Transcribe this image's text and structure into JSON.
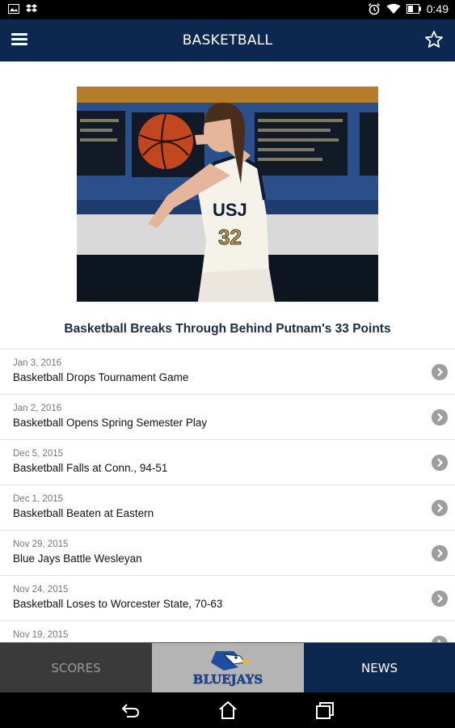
{
  "status_bar": {
    "time": "0:49",
    "left_icons": [
      "gallery-icon",
      "dropbox-icon"
    ],
    "right_icons": [
      "alarm-icon",
      "wifi-icon",
      "battery-icon"
    ]
  },
  "app_bar": {
    "title": "BASKETBALL",
    "left_icon": "menu-icon",
    "right_icon": "star-icon",
    "color": "#0d2850"
  },
  "hero": {
    "jersey_text": "USJ",
    "jersey_number": "32",
    "headline": "Basketball Breaks Through Behind Putnam's 33 Points"
  },
  "news": [
    {
      "date": "Jan 3, 2016",
      "title": "Basketball Drops Tournament Game"
    },
    {
      "date": "Jan 2, 2016",
      "title": "Basketball Opens Spring Semester Play"
    },
    {
      "date": "Dec 5, 2015",
      "title": "Basketball Falls at Conn., 94-51"
    },
    {
      "date": "Dec 1, 2015",
      "title": "Basketball Beaten at Eastern"
    },
    {
      "date": "Nov 29, 2015",
      "title": "Blue Jays Battle Wesleyan"
    },
    {
      "date": "Nov 24, 2015",
      "title": "Basketball Loses to Worcester State, 70-63"
    },
    {
      "date": "Nov 19, 2015",
      "title": ""
    }
  ],
  "tabs": {
    "scores": "SCORES",
    "logo_text": "BLUEJAYS",
    "news": "NEWS",
    "active": "news"
  },
  "nav_bar": {
    "icons": [
      "back-icon",
      "home-icon",
      "recents-icon"
    ]
  }
}
